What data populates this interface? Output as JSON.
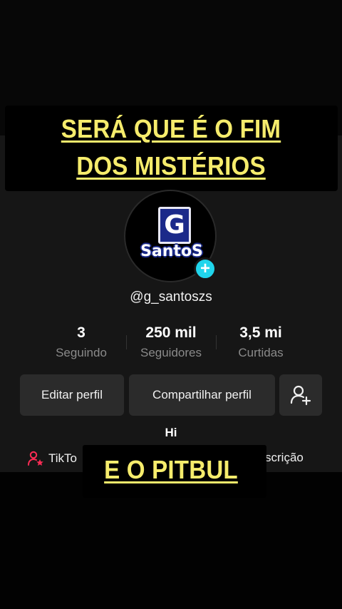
{
  "overlay": {
    "caption_line1": "SERÁ QUE É O FIM",
    "caption_line2": "DOS MISTÉRIOS",
    "caption_bottom": "E O PITBUL"
  },
  "profile": {
    "avatar_logo_letter": "G",
    "avatar_logo_word": "SantoS",
    "username": "@g_santoszs",
    "stats": [
      {
        "value": "3",
        "label": "Seguindo"
      },
      {
        "value": "250 mil",
        "label": "Seguidores"
      },
      {
        "value": "3,5 mi",
        "label": "Curtidas"
      }
    ],
    "buttons": {
      "edit": "Editar perfil",
      "share": "Compartilhar perfil"
    },
    "bio": "Hi",
    "links": {
      "tiktok": "TikTo",
      "subscription": "scrição"
    }
  },
  "colors": {
    "caption_yellow": "#f6ec6c",
    "accent_cyan": "#20d5ec",
    "tiktok_pink": "#fe2c55"
  },
  "icons": {
    "plus_badge": "plus-icon",
    "add_friend": "add-friend-icon",
    "tiktok_link": "person-star-icon"
  }
}
